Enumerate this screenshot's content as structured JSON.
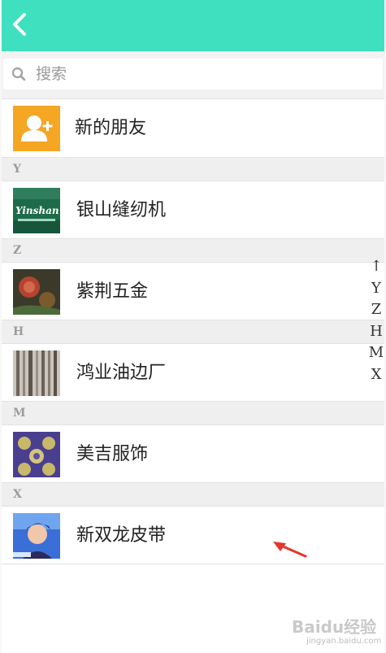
{
  "header": {
    "back_icon": "chevron-left-icon",
    "color": "#3fe0bf"
  },
  "search": {
    "placeholder": "搜索",
    "value": ""
  },
  "new_friends": {
    "label": "新的朋友",
    "icon": "add-user-icon",
    "color": "#f5a623"
  },
  "contacts": [
    {
      "section": "Y",
      "name": "银山缝纫机"
    },
    {
      "section": "Z",
      "name": "紫荆五金"
    },
    {
      "section": "H",
      "name": "鸿业油边厂"
    },
    {
      "section": "M",
      "name": "美吉服饰"
    },
    {
      "section": "X",
      "name": "新双龙皮带"
    }
  ],
  "index_bar": [
    "↑",
    "Y",
    "Z",
    "H",
    "M",
    "X"
  ],
  "avatar_logo_text": "Yinshan",
  "watermark": {
    "text": "Baidu经验",
    "sub": "jingyan.baidu.com"
  }
}
